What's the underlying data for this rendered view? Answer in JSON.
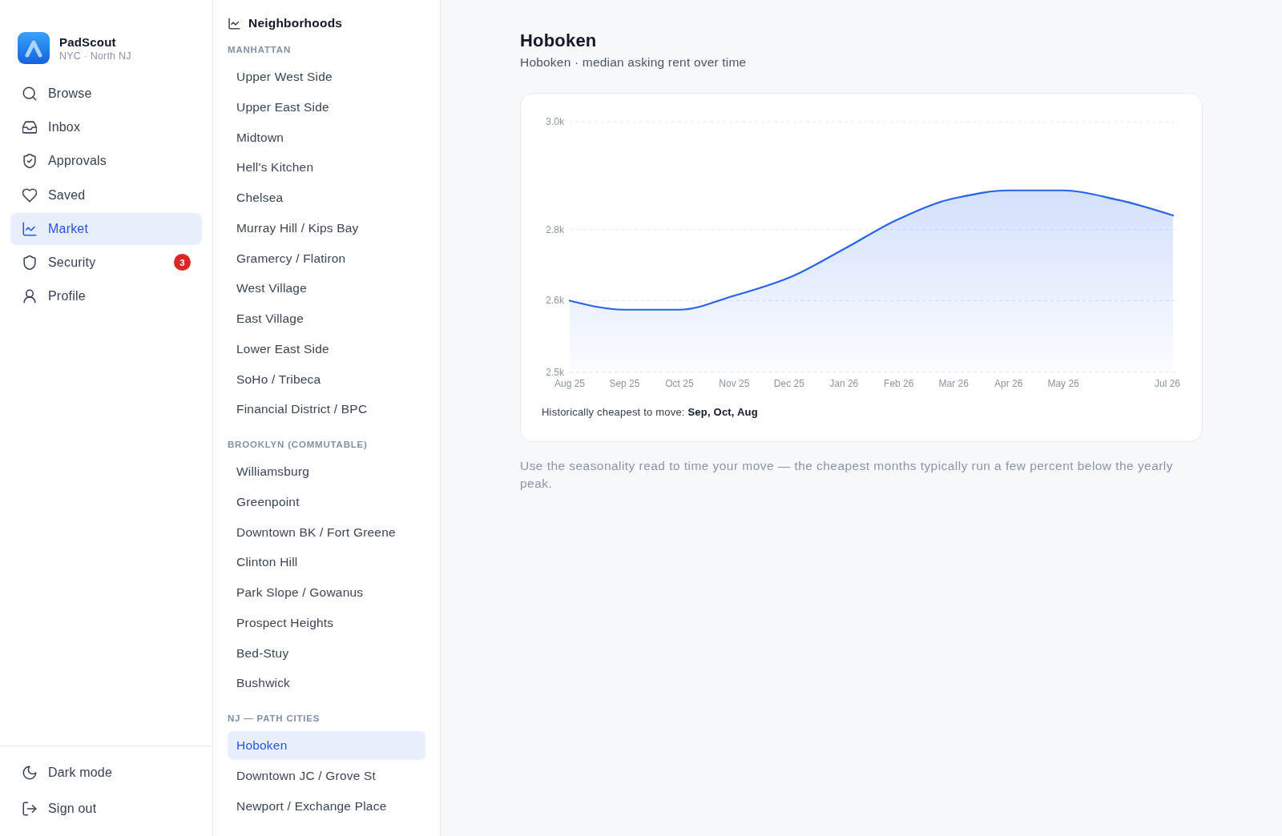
{
  "app": {
    "name": "PadScout",
    "region": "NYC · North NJ"
  },
  "nav": [
    {
      "label": "Browse",
      "selected": false
    },
    {
      "label": "Inbox",
      "selected": false
    },
    {
      "label": "Approvals",
      "selected": false
    },
    {
      "label": "Saved",
      "selected": false
    },
    {
      "label": "Market",
      "selected": true
    },
    {
      "label": "Security",
      "selected": false,
      "badge": "3"
    },
    {
      "label": "Profile",
      "selected": false
    }
  ],
  "nav_footer": [
    {
      "label": "Dark mode"
    },
    {
      "label": "Sign out"
    }
  ],
  "neighborhoods": {
    "title": "Neighborhoods",
    "groups": [
      {
        "label": "MANHATTAN",
        "items": [
          {
            "name": "Upper West Side",
            "selected": false
          },
          {
            "name": "Upper East Side",
            "selected": false
          },
          {
            "name": "Midtown",
            "selected": false
          },
          {
            "name": "Hell's Kitchen",
            "selected": false
          },
          {
            "name": "Chelsea",
            "selected": false
          },
          {
            "name": "Murray Hill / Kips Bay",
            "selected": false
          },
          {
            "name": "Gramercy / Flatiron",
            "selected": false
          },
          {
            "name": "West Village",
            "selected": false
          },
          {
            "name": "East Village",
            "selected": false
          },
          {
            "name": "Lower East Side",
            "selected": false
          },
          {
            "name": "SoHo / Tribeca",
            "selected": false
          },
          {
            "name": "Financial District / BPC",
            "selected": false
          }
        ]
      },
      {
        "label": "BROOKLYN (COMMUTABLE)",
        "items": [
          {
            "name": "Williamsburg",
            "selected": false
          },
          {
            "name": "Greenpoint",
            "selected": false
          },
          {
            "name": "Downtown BK / Fort Greene",
            "selected": false
          },
          {
            "name": "Clinton Hill",
            "selected": false
          },
          {
            "name": "Park Slope / Gowanus",
            "selected": false
          },
          {
            "name": "Prospect Heights",
            "selected": false
          },
          {
            "name": "Bed-Stuy",
            "selected": false
          },
          {
            "name": "Bushwick",
            "selected": false
          }
        ]
      },
      {
        "label": "NJ — PATH CITIES",
        "items": [
          {
            "name": "Hoboken",
            "selected": true
          },
          {
            "name": "Downtown JC / Grove St",
            "selected": false
          },
          {
            "name": "Newport / Exchange Place",
            "selected": false
          }
        ]
      }
    ]
  },
  "detail": {
    "title": "Hoboken",
    "subtitle": "Hoboken · median asking rent over time",
    "chart_data": {
      "type": "area",
      "categories": [
        "Aug 25",
        "Sep 25",
        "Oct 25",
        "Nov 25",
        "Dec 25",
        "Jan 26",
        "Feb 26",
        "Mar 26",
        "Apr 26",
        "May 26",
        null,
        "Jul 26"
      ],
      "ylim": [
        2500,
        3000
      ],
      "yticks": [
        {
          "value": 2500,
          "label": "2.5k"
        },
        {
          "value": 2643,
          "label": "2.6k"
        },
        {
          "value": 2785,
          "label": "2.8k"
        },
        {
          "value": 3000,
          "label": "3.0k"
        }
      ],
      "series": [
        {
          "color": "#2563eb",
          "values": [
            2643,
            2625,
            2625,
            2653,
            2689,
            2746,
            2806,
            2847,
            2863,
            2863,
            2844,
            2813
          ]
        }
      ]
    },
    "cheapest": "Historically cheapest to move: **Sep, Oct, Aug**",
    "note": "Use the seasonality read to time your move — the cheapest months typically run a few percent below the yearly peak."
  }
}
